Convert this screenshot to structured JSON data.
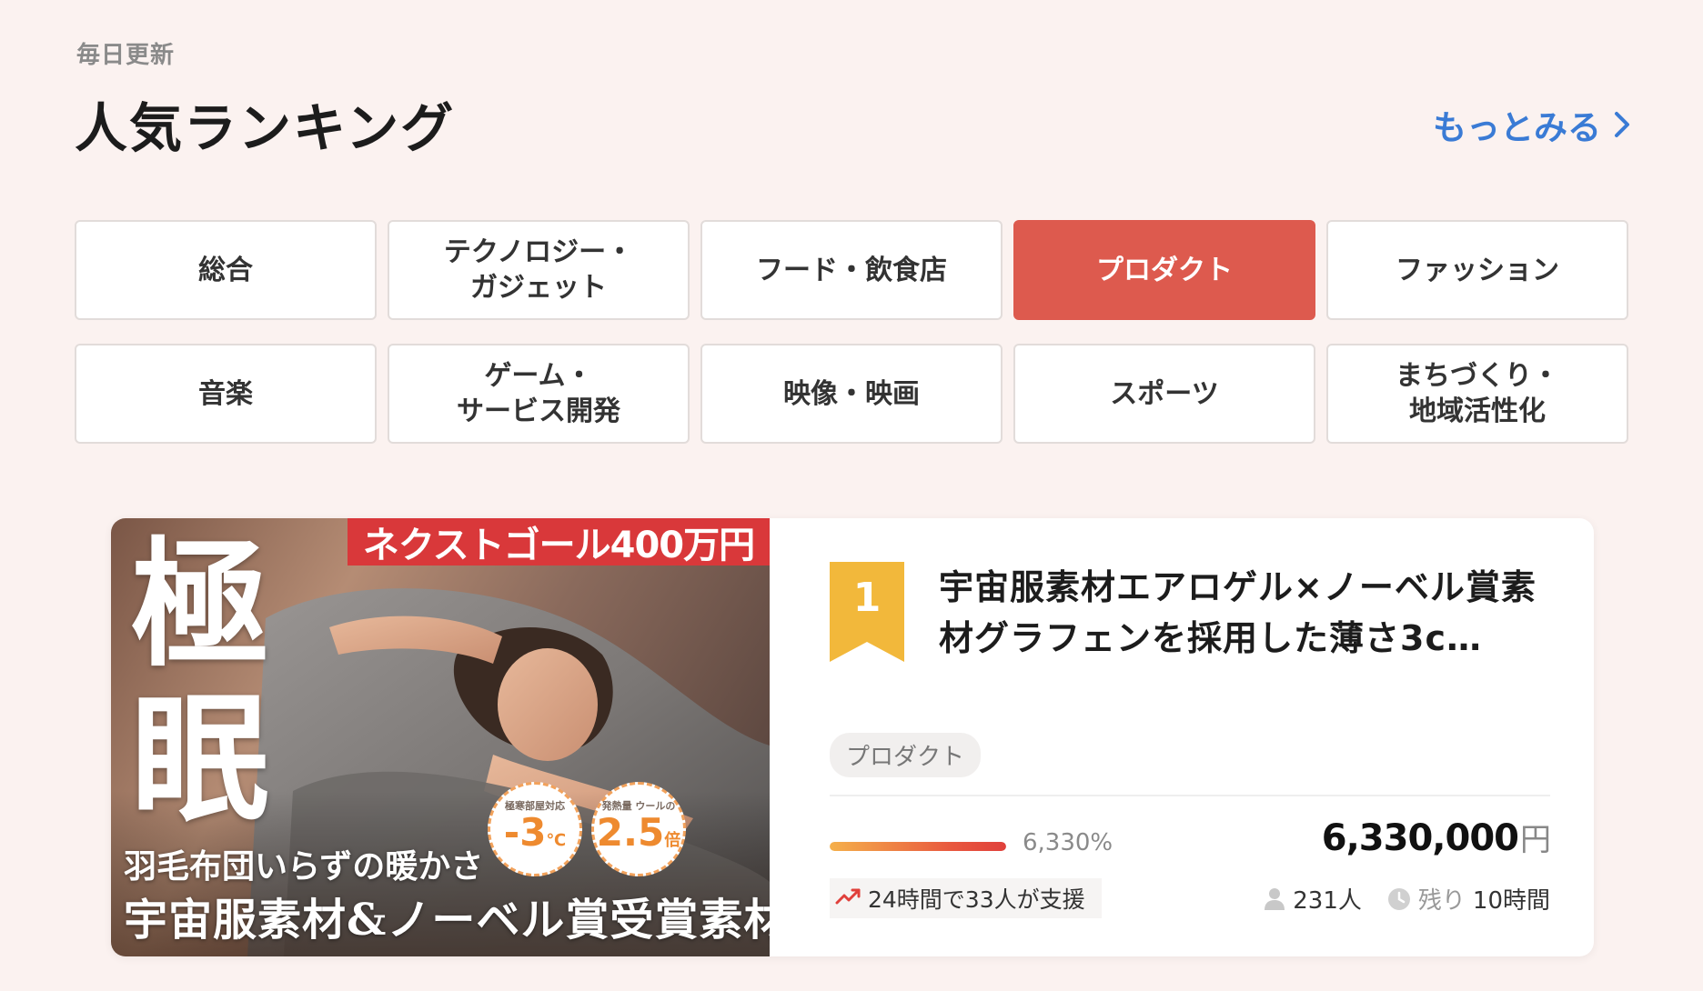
{
  "header": {
    "eyebrow": "毎日更新",
    "title": "人気ランキング",
    "more_label": "もっとみる"
  },
  "categories": [
    {
      "label": "総合",
      "active": false
    },
    {
      "label": "テクノロジー・\nガジェット",
      "active": false
    },
    {
      "label": "フード・飲食店",
      "active": false
    },
    {
      "label": "プロダクト",
      "active": true
    },
    {
      "label": "ファッション",
      "active": false
    },
    {
      "label": "音楽",
      "active": false
    },
    {
      "label": "ゲーム・\nサービス開発",
      "active": false
    },
    {
      "label": "映像・映画",
      "active": false
    },
    {
      "label": "スポーツ",
      "active": false
    },
    {
      "label": "まちづくり・\n地域活性化",
      "active": false
    }
  ],
  "colors": {
    "accent": "#dd5a4e",
    "link": "#3a7bd5",
    "rank_gold": "#f2b83b"
  },
  "project": {
    "rank": "1",
    "title": "宇宙服素材エアロゲル×ノーベル賞素材グラフェンを採用した薄さ3c…",
    "tag": "プロダクト",
    "percent_label": "6,330%",
    "progress": 1.0,
    "amount": "6,330,000",
    "currency": "円",
    "trend_label": "24時間で33人が支援",
    "backers": "231人",
    "remaining_prefix": "残り",
    "remaining_value": "10時間",
    "thumbnail": {
      "goal_banner": "ネクストゴール400万円",
      "headline": "極眠",
      "subline": "羽毛布団いらずの暖かさ",
      "mainline": "宇宙服素材&ノーベル賞受賞素材",
      "badge1_small": "極寒部屋対応",
      "badge1_big": "-3",
      "badge1_unit": "℃",
      "badge2_small": "発熱量 ウールの",
      "badge2_big": "2.5",
      "badge2_unit": "倍"
    }
  }
}
